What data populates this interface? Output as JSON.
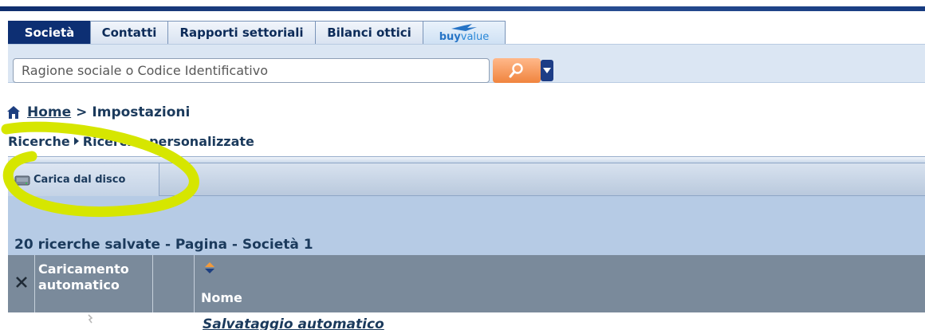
{
  "tabs": [
    {
      "label": "Società",
      "active": true
    },
    {
      "label": "Contatti",
      "active": false
    },
    {
      "label": "Rapporti settoriali",
      "active": false
    },
    {
      "label": "Bilanci ottici",
      "active": false
    }
  ],
  "logo_tab": {
    "part1": "buy",
    "part2": "value"
  },
  "search": {
    "placeholder": "Ragione sociale o Codice Identificativo",
    "value": ""
  },
  "breadcrumb": {
    "home": "Home",
    "separator": ">",
    "current": "Impostazioni"
  },
  "subnav": {
    "parent": "Ricerche",
    "current": "Ricerche personalizzate"
  },
  "toolbar": {
    "load_label": "Carica dal disco"
  },
  "results": {
    "title": "20 ricerche salvate - Pagina - Società 1"
  },
  "table": {
    "columns": {
      "auto_load_line1": "Caricamento",
      "auto_load_line2": "automatico",
      "name": "Nome"
    },
    "rows": [
      {
        "name": "Salvataggio automatico"
      }
    ]
  },
  "colors": {
    "primary": "#0d2f73",
    "accent": "#f0843e",
    "highlight": "#d6e600",
    "header": "#7a8a9b"
  }
}
